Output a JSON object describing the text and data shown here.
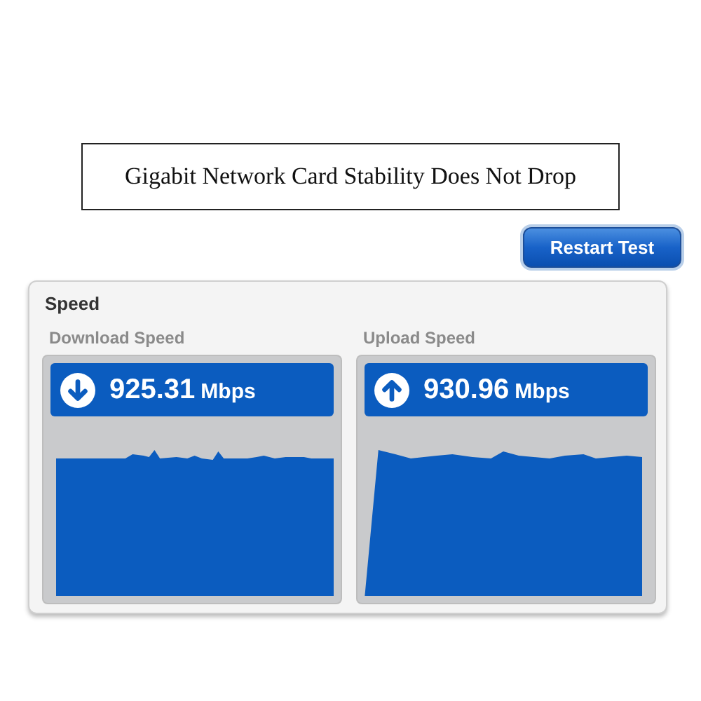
{
  "caption": "Gigabit Network Card Stability Does Not Drop",
  "restart_button": "Restart Test",
  "panel": {
    "title": "Speed",
    "gauges": [
      {
        "label": "Download Speed",
        "kind": "download",
        "value": "925.31",
        "unit": "Mbps"
      },
      {
        "label": "Upload Speed",
        "kind": "upload",
        "value": "930.96",
        "unit": "Mbps"
      }
    ]
  }
}
